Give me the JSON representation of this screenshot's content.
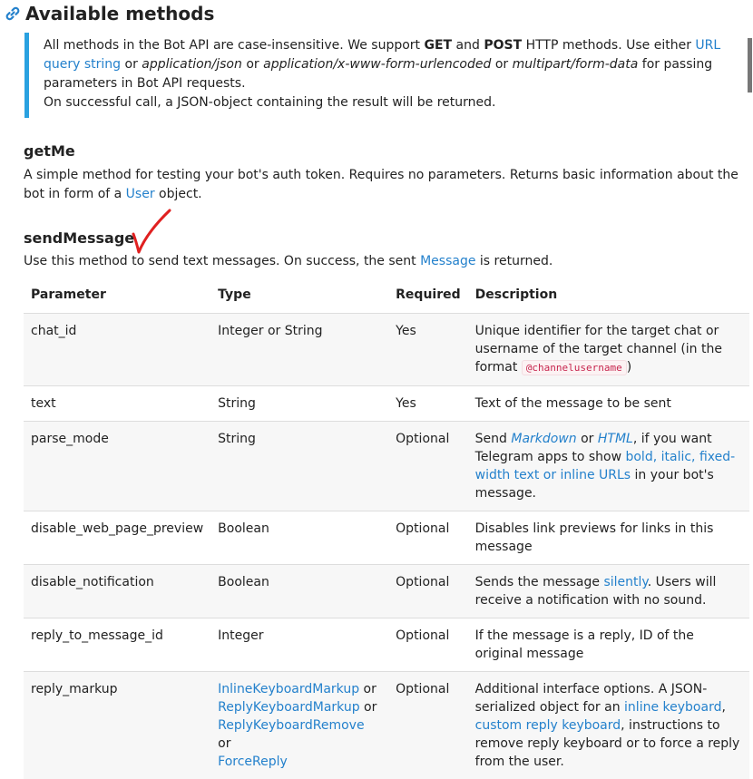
{
  "section": {
    "title": "Available methods",
    "anchor_icon": "link-icon"
  },
  "callout": {
    "p1_a": "All methods in the Bot API are case-insensitive. We support ",
    "p1_get": "GET",
    "p1_and": " and ",
    "p1_post": "POST",
    "p1_b": " HTTP methods. Use either ",
    "p1_link": "URL query string",
    "p1_c": " or ",
    "p1_json": "application/json",
    "p1_d": " or ",
    "p1_form": "application/x-www-form-urlencoded",
    "p1_e": " or ",
    "p1_multi": "multipart/form-data",
    "p1_f": " for passing parameters in Bot API requests.",
    "p2": "On successful call, a JSON-object containing the result will be returned."
  },
  "getMe": {
    "title": "getMe",
    "desc_a": "A simple method for testing your bot's auth token. Requires no parameters. Returns basic information about the bot in form of a ",
    "desc_link": "User",
    "desc_b": " object."
  },
  "sendMessage": {
    "title": "sendMessage",
    "desc_a": "Use this method to send text messages. On success, the sent ",
    "desc_link": "Message",
    "desc_b": " is returned.",
    "annotation_icon": "red-checkmark-icon"
  },
  "table": {
    "headers": [
      "Parameter",
      "Type",
      "Required",
      "Description"
    ],
    "rows": [
      {
        "param": "chat_id",
        "type": "Integer or String",
        "required": "Yes",
        "desc_a": "Unique identifier for the target chat or username of the target channel (in the format ",
        "desc_code": "@channelusername",
        "desc_b": ")"
      },
      {
        "param": "text",
        "type": "String",
        "required": "Yes",
        "desc_a": "Text of the message to be sent"
      },
      {
        "param": "parse_mode",
        "type": "String",
        "required": "Optional",
        "desc_a": "Send ",
        "desc_link1": "Markdown",
        "desc_mid": " or ",
        "desc_link2": "HTML",
        "desc_b": ", if you want Telegram apps to show ",
        "desc_link3": "bold, italic, fixed-width text or inline URLs",
        "desc_c": " in your bot's message."
      },
      {
        "param": "disable_web_page_preview",
        "type": "Boolean",
        "required": "Optional",
        "desc_a": "Disables link previews for links in this message"
      },
      {
        "param": "disable_notification",
        "type": "Boolean",
        "required": "Optional",
        "desc_a": "Sends the message ",
        "desc_link1": "silently",
        "desc_b": ". Users will receive a notification with no sound."
      },
      {
        "param": "reply_to_message_id",
        "type": "Integer",
        "required": "Optional",
        "desc_a": "If the message is a reply, ID of the original message"
      },
      {
        "param": "reply_markup",
        "type_links": [
          "InlineKeyboardMarkup",
          "ReplyKeyboardMarkup",
          "ReplyKeyboardRemove",
          "ForceReply"
        ],
        "type_sep": " or",
        "required": "Optional",
        "desc_a": "Additional interface options. A JSON-serialized object for an ",
        "desc_link1": "inline keyboard",
        "desc_mid": ", ",
        "desc_link2": "custom reply keyboard",
        "desc_b": ", instructions to remove reply keyboard or to force a reply from the user."
      }
    ]
  }
}
